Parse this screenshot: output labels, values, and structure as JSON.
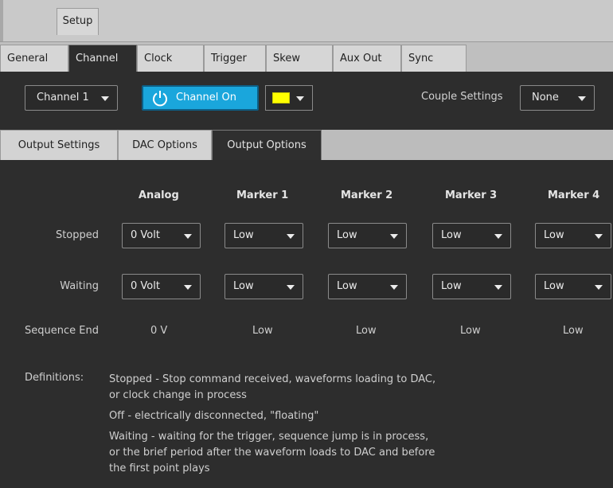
{
  "top": {
    "setup_tab": "Setup"
  },
  "tabs": [
    "General",
    "Channel",
    "Clock",
    "Trigger",
    "Skew",
    "Aux Out",
    "Sync"
  ],
  "channel_row": {
    "channel_select": "Channel 1",
    "channel_on_label": "Channel On",
    "color_swatch": "#ffff00",
    "couple_label": "Couple Settings",
    "couple_value": "None"
  },
  "subtabs": [
    "Output Settings",
    "DAC Options",
    "Output Options"
  ],
  "table": {
    "columns": [
      "Analog",
      "Marker 1",
      "Marker 2",
      "Marker 3",
      "Marker 4"
    ],
    "rows": {
      "stopped": {
        "label": "Stopped",
        "values": [
          "0 Volt",
          "Low",
          "Low",
          "Low",
          "Low"
        ]
      },
      "waiting": {
        "label": "Waiting",
        "values": [
          "0 Volt",
          "Low",
          "Low",
          "Low",
          "Low"
        ]
      },
      "sequence_end": {
        "label": "Sequence End",
        "values": [
          "0 V",
          "Low",
          "Low",
          "Low",
          "Low"
        ]
      }
    }
  },
  "definitions": {
    "label": "Definitions:",
    "stopped_line1": "Stopped - Stop command received, waveforms loading to DAC,",
    "stopped_line2": "or clock change in process",
    "off_line": "Off - electrically disconnected, \"floating\"",
    "waiting_line1": "Waiting - waiting for the trigger, sequence jump is in process,",
    "waiting_line2": "or the brief period after the waveform loads to DAC and before",
    "waiting_line3": "the first point plays"
  }
}
